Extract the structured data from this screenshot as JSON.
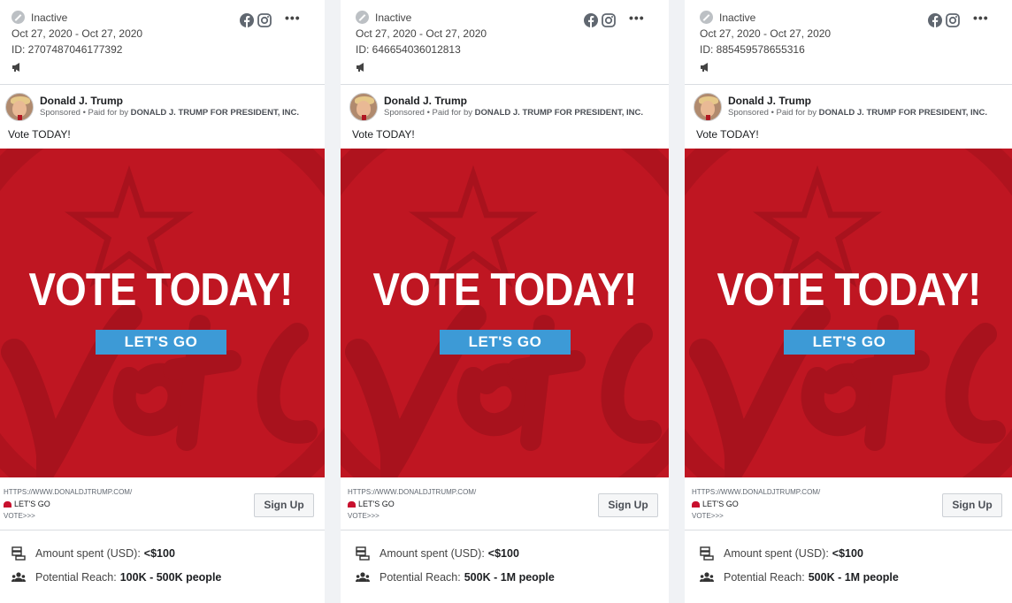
{
  "cards": [
    {
      "status": "Inactive",
      "dates": "Oct 27, 2020 - Oct 27, 2020",
      "id": "ID: 2707487046177392",
      "page_name": "Donald J. Trump",
      "sponsored": "Sponsored",
      "paid_for_prefix": "• Paid for by",
      "paid_for": "DONALD J. TRUMP FOR PRESIDENT, INC.",
      "body": "Vote TODAY!",
      "headline": "VOTE TODAY!",
      "creative_cta": "LET'S GO",
      "link_url": "HTTPS://WWW.DONALDJTRUMP.COM/",
      "link_title": "LET'S GO",
      "link_desc": "VOTE>>>",
      "button": "Sign Up",
      "spent_label": "Amount spent (USD):",
      "spent_value": "<$100",
      "reach_label": "Potential Reach:",
      "reach_value": "100K - 500K people"
    },
    {
      "status": "Inactive",
      "dates": "Oct 27, 2020 - Oct 27, 2020",
      "id": "ID: 646654036012813",
      "page_name": "Donald J. Trump",
      "sponsored": "Sponsored",
      "paid_for_prefix": "• Paid for by",
      "paid_for": "DONALD J. TRUMP FOR PRESIDENT, INC.",
      "body": "Vote TODAY!",
      "headline": "VOTE TODAY!",
      "creative_cta": "LET'S GO",
      "link_url": "HTTPS://WWW.DONALDJTRUMP.COM/",
      "link_title": "LET'S GO",
      "link_desc": "VOTE>>>",
      "button": "Sign Up",
      "spent_label": "Amount spent (USD):",
      "spent_value": "<$100",
      "reach_label": "Potential Reach:",
      "reach_value": "500K - 1M people"
    },
    {
      "status": "Inactive",
      "dates": "Oct 27, 2020 - Oct 27, 2020",
      "id": "ID: 885459578655316",
      "page_name": "Donald J. Trump",
      "sponsored": "Sponsored",
      "paid_for_prefix": "• Paid for by",
      "paid_for": "DONALD J. TRUMP FOR PRESIDENT, INC.",
      "body": "Vote TODAY!",
      "headline": "VOTE TODAY!",
      "creative_cta": "LET'S GO",
      "link_url": "HTTPS://WWW.DONALDJTRUMP.COM/",
      "link_title": "LET'S GO",
      "link_desc": "VOTE>>>",
      "button": "Sign Up",
      "spent_label": "Amount spent (USD):",
      "spent_value": "<$100",
      "reach_label": "Potential Reach:",
      "reach_value": "500K - 1M people"
    }
  ],
  "icons": {
    "status": "inactive-status-icon",
    "platforms": [
      "facebook-icon",
      "instagram-icon"
    ],
    "more": "more-options-icon",
    "ad": "megaphone-icon",
    "spent": "money-stack-icon",
    "reach": "people-icon"
  },
  "colors": {
    "creative_red": "#bf1622",
    "cta_blue": "#3d9ad6",
    "page_bg": "#f0f2f5"
  }
}
